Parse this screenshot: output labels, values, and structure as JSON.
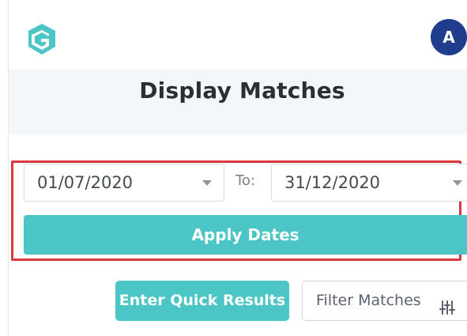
{
  "header": {
    "logo_icon": "g-logo-icon",
    "avatar_initial": "A",
    "avatar_color": "#1f3d8c",
    "brand_color": "#4cc5c6"
  },
  "page": {
    "title": "Display Matches"
  },
  "date_range": {
    "from_value": "01/07/2020",
    "to_label": "To:",
    "to_value": "31/12/2020",
    "apply_label": "Apply Dates",
    "highlight_color": "#d9383e"
  },
  "actions": {
    "quick_results_label": "Enter Quick Results",
    "filter_label": "Filter Matches",
    "filter_icon": "sliders-icon"
  }
}
